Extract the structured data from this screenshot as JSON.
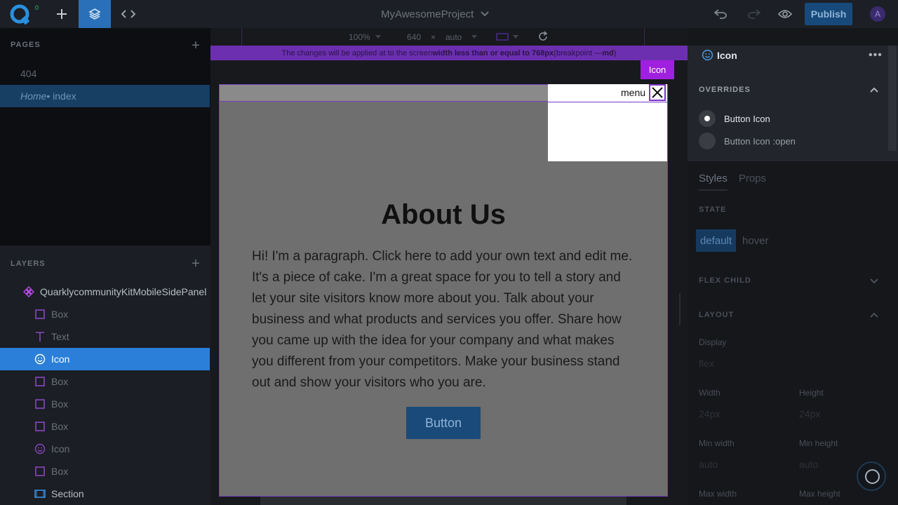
{
  "topbar": {
    "notification_count": "0",
    "project_name": "MyAwesomeProject",
    "publish_label": "Publish",
    "avatar_initial": "A"
  },
  "pages": {
    "title": "PAGES",
    "items": [
      {
        "label": "404"
      },
      {
        "label": "Home",
        "suffix": " • index"
      }
    ]
  },
  "layers": {
    "title": "LAYERS",
    "root": "QuarklycommunityKitMobileSidePanel",
    "items": [
      {
        "label": "Box",
        "icon": "box-icon"
      },
      {
        "label": "Text",
        "icon": "text-icon"
      },
      {
        "label": "Icon",
        "icon": "smiley-icon"
      },
      {
        "label": "Box",
        "icon": "box-icon"
      },
      {
        "label": "Box",
        "icon": "box-icon"
      },
      {
        "label": "Box",
        "icon": "box-icon"
      },
      {
        "label": "Icon",
        "icon": "smiley-icon"
      },
      {
        "label": "Box",
        "icon": "box-icon"
      },
      {
        "label": "Section",
        "icon": "section-icon"
      }
    ]
  },
  "canvas": {
    "zoom": "100%",
    "width": "640",
    "times": "×",
    "height": "auto",
    "breakpoint_prefix": "The changes will be applied at to the screen ",
    "breakpoint_bold": "width less than or equal to 768px",
    "breakpoint_mid": " (breakpoint — ",
    "breakpoint_name": "md",
    "breakpoint_end": ")",
    "add_plus": "+",
    "icon_tag": "Icon",
    "menu_label": "menu",
    "about_title": "About Us",
    "about_text": "Hi! I'm a paragraph. Click here to add your own text and edit me. It's a piece of cake. I'm a great space for you to tell a story and let your site visitors know more about you. Talk about your business and what products and services you offer. Share how you came up with the idea for your company and what makes you different from your competitors. Make your business stand out and show your visitors who you are.",
    "button_label": "Button"
  },
  "rightpanel": {
    "title": "Icon",
    "overrides_title": "OVERRIDES",
    "overrides": [
      {
        "label": "Button Icon",
        "selected": true
      },
      {
        "label": "Button Icon :open",
        "selected": false
      }
    ],
    "tabs": [
      {
        "label": "Styles"
      },
      {
        "label": "Props"
      }
    ],
    "state_title": "STATE",
    "states": [
      {
        "label": "default"
      },
      {
        "label": "hover"
      }
    ],
    "flex_child_title": "FLEX CHILD",
    "layout_title": "LAYOUT",
    "display_label": "Display",
    "display_value": "flex",
    "width_label": "Width",
    "width_value": "24px",
    "height_label": "Height",
    "height_value": "24px",
    "min_width_label": "Min width",
    "min_width_value": "auto",
    "min_height_label": "Min height",
    "min_height_value": "auto",
    "max_width_label": "Max width",
    "max_height_label": "Max height"
  },
  "colors": {
    "accent": "#2b7fd8",
    "breakpoint": "#6c2fb0",
    "icon_purple": "#a020e0"
  }
}
